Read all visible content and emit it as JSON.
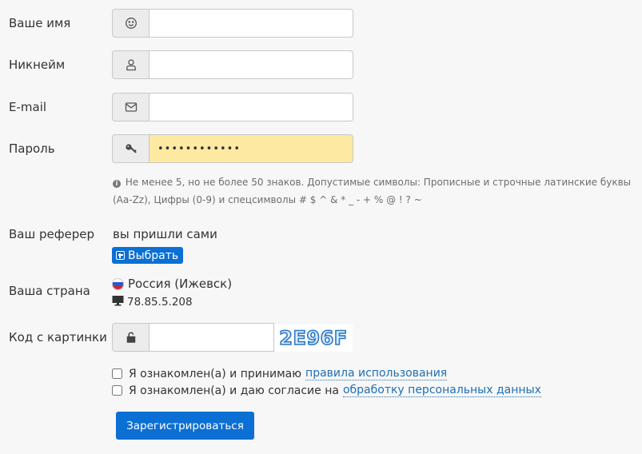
{
  "form": {
    "name": {
      "label": "Ваше имя",
      "value": "",
      "icon": "smile-icon"
    },
    "nickname": {
      "label": "Никнейм",
      "value": "",
      "icon": "user-icon"
    },
    "email": {
      "label": "E-mail",
      "value": "",
      "icon": "envelope-icon"
    },
    "password": {
      "label": "Пароль",
      "value": "••••••••••••",
      "icon": "key-icon",
      "highlight_color": "#fde9a2"
    },
    "password_hint": "Не менее 5, но не более 50 знаков. Допустимые символы: Прописные и строчные латинские буквы (Aa-Zz), Цифры (0-9) и спецсимволы # $ ^ & * _ - + % @ ! ? ~",
    "referrer": {
      "label": "Ваш реферер",
      "value": "вы пришли сами",
      "button_label": "Выбрать"
    },
    "country": {
      "label": "Ваша страна",
      "value": "Россия (Ижевск)",
      "ip": "78.85.5.208",
      "flag": "russia-flag-icon",
      "ip_icon": "monitor-icon"
    },
    "captcha": {
      "label": "Код с картинки",
      "value": "",
      "icon": "unlock-icon",
      "image_text": "2E96F"
    },
    "agree_terms": {
      "text": "Я ознакомлен(а) и принимаю",
      "link": "правила использования",
      "checked": false
    },
    "agree_privacy": {
      "text": "Я ознакомлен(а) и даю согласие на",
      "link": "обработку персональных данных",
      "checked": false
    },
    "submit_label": "Зарегистрироваться"
  },
  "colors": {
    "accent": "#0b6fd4",
    "link": "#1f6fb5",
    "background": "#f7f7f7"
  }
}
